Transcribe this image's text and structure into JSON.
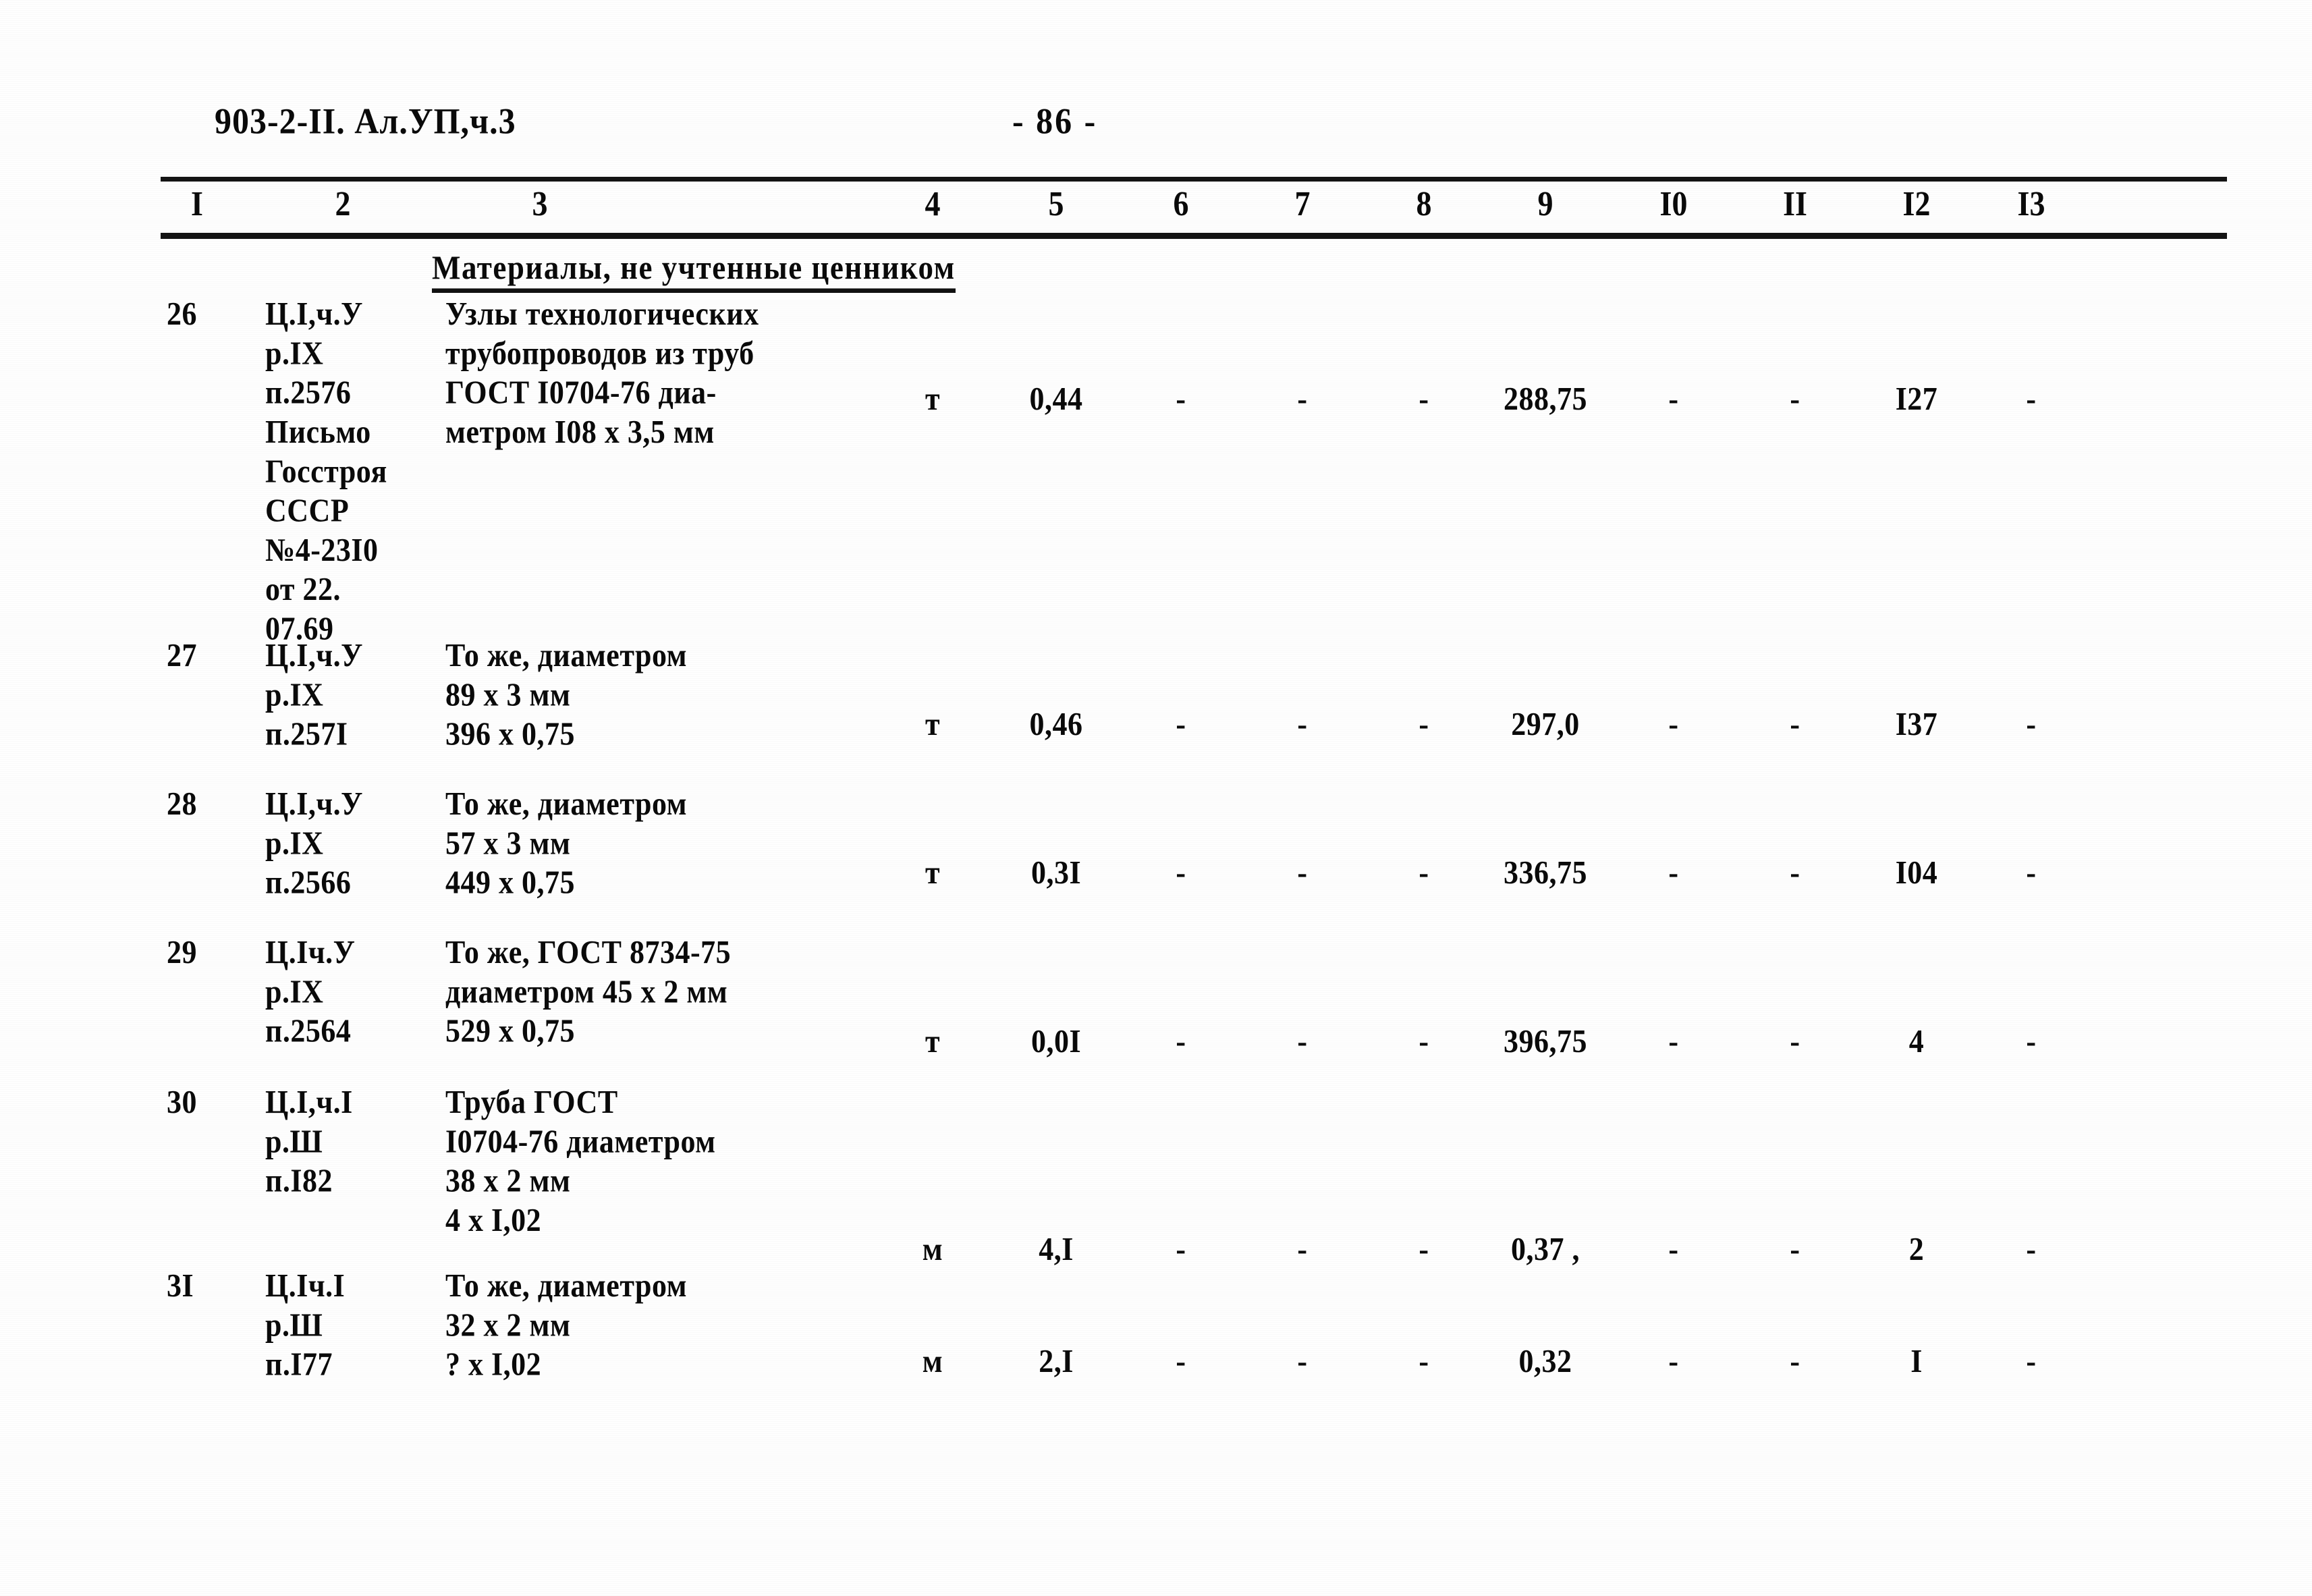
{
  "header": {
    "doc_code": "903-2-II. Ал.УП,ч.3",
    "page_number": "- 86 -"
  },
  "table": {
    "column_numbers": [
      "I",
      "2",
      "3",
      "4",
      "5",
      "6",
      "7",
      "8",
      "9",
      "I0",
      "II",
      "I2",
      "I3"
    ],
    "section_title": "Материалы, не учтенные ценником",
    "rows": [
      {
        "num": "26",
        "code": "Ц.I,ч.У\nр.IХ\nп.2576\nПисьмо\nГосстроя\nСССР\n№4-23I0\nот 22.\n07.69",
        "description": "Узлы технологических\nтрубопроводов из труб\nГОСТ I0704-76 диа-\nметром I08 х 3,5 мм",
        "unit": "т",
        "qty": "0,44",
        "c6": "-",
        "c7": "-",
        "c8": "-",
        "price": "288,75",
        "c10": "-",
        "c11": "-",
        "total": "I27",
        "c13": "-"
      },
      {
        "num": "27",
        "code": "Ц.I,ч.У\nр.IХ\nп.257I",
        "description": "То же, диаметром\n89 х 3 мм\n396 х 0,75",
        "unit": "т",
        "qty": "0,46",
        "c6": "-",
        "c7": "-",
        "c8": "-",
        "price": "297,0",
        "c10": "-",
        "c11": "-",
        "total": "I37",
        "c13": "-"
      },
      {
        "num": "28",
        "code": "Ц.I,ч.У\nр.IХ\nп.2566",
        "description": "То же, диаметром\n57 х 3 мм\n449 х 0,75",
        "unit": "т",
        "qty": "0,3I",
        "c6": "-",
        "c7": "-",
        "c8": "-",
        "price": "336,75",
        "c10": "-",
        "c11": "-",
        "total": "I04",
        "c13": "-"
      },
      {
        "num": "29",
        "code": "Ц.Iч.У\nр.IХ\nп.2564",
        "description": "То же, ГОСТ 8734-75\nдиаметром 45 х 2 мм\n529 х 0,75",
        "unit": "т",
        "qty": "0,0I",
        "c6": "-",
        "c7": "-",
        "c8": "-",
        "price": "396,75",
        "c10": "-",
        "c11": "-",
        "total": "4",
        "c13": "-"
      },
      {
        "num": "30",
        "code": "Ц.I,ч.I\nр.Ш\nп.I82",
        "description": "Труба ГОСТ\nI0704-76 диаметром\n38 х 2 мм\n4 х I,02",
        "unit": "м",
        "qty": "4,I",
        "c6": "-",
        "c7": "-",
        "c8": "-",
        "price": "0,37 ,",
        "c10": "-",
        "c11": "-",
        "total": "2",
        "c13": "-"
      },
      {
        "num": "3I",
        "code": "Ц.Iч.I\nр.Ш\nп.I77",
        "description": "То же, диаметром\n32 х 2 мм\n? х I,02",
        "unit": "м",
        "qty": "2,I",
        "c6": "-",
        "c7": "-",
        "c8": "-",
        "price": "0,32",
        "c10": "-",
        "c11": "-",
        "total": "I",
        "c13": "-"
      }
    ]
  }
}
